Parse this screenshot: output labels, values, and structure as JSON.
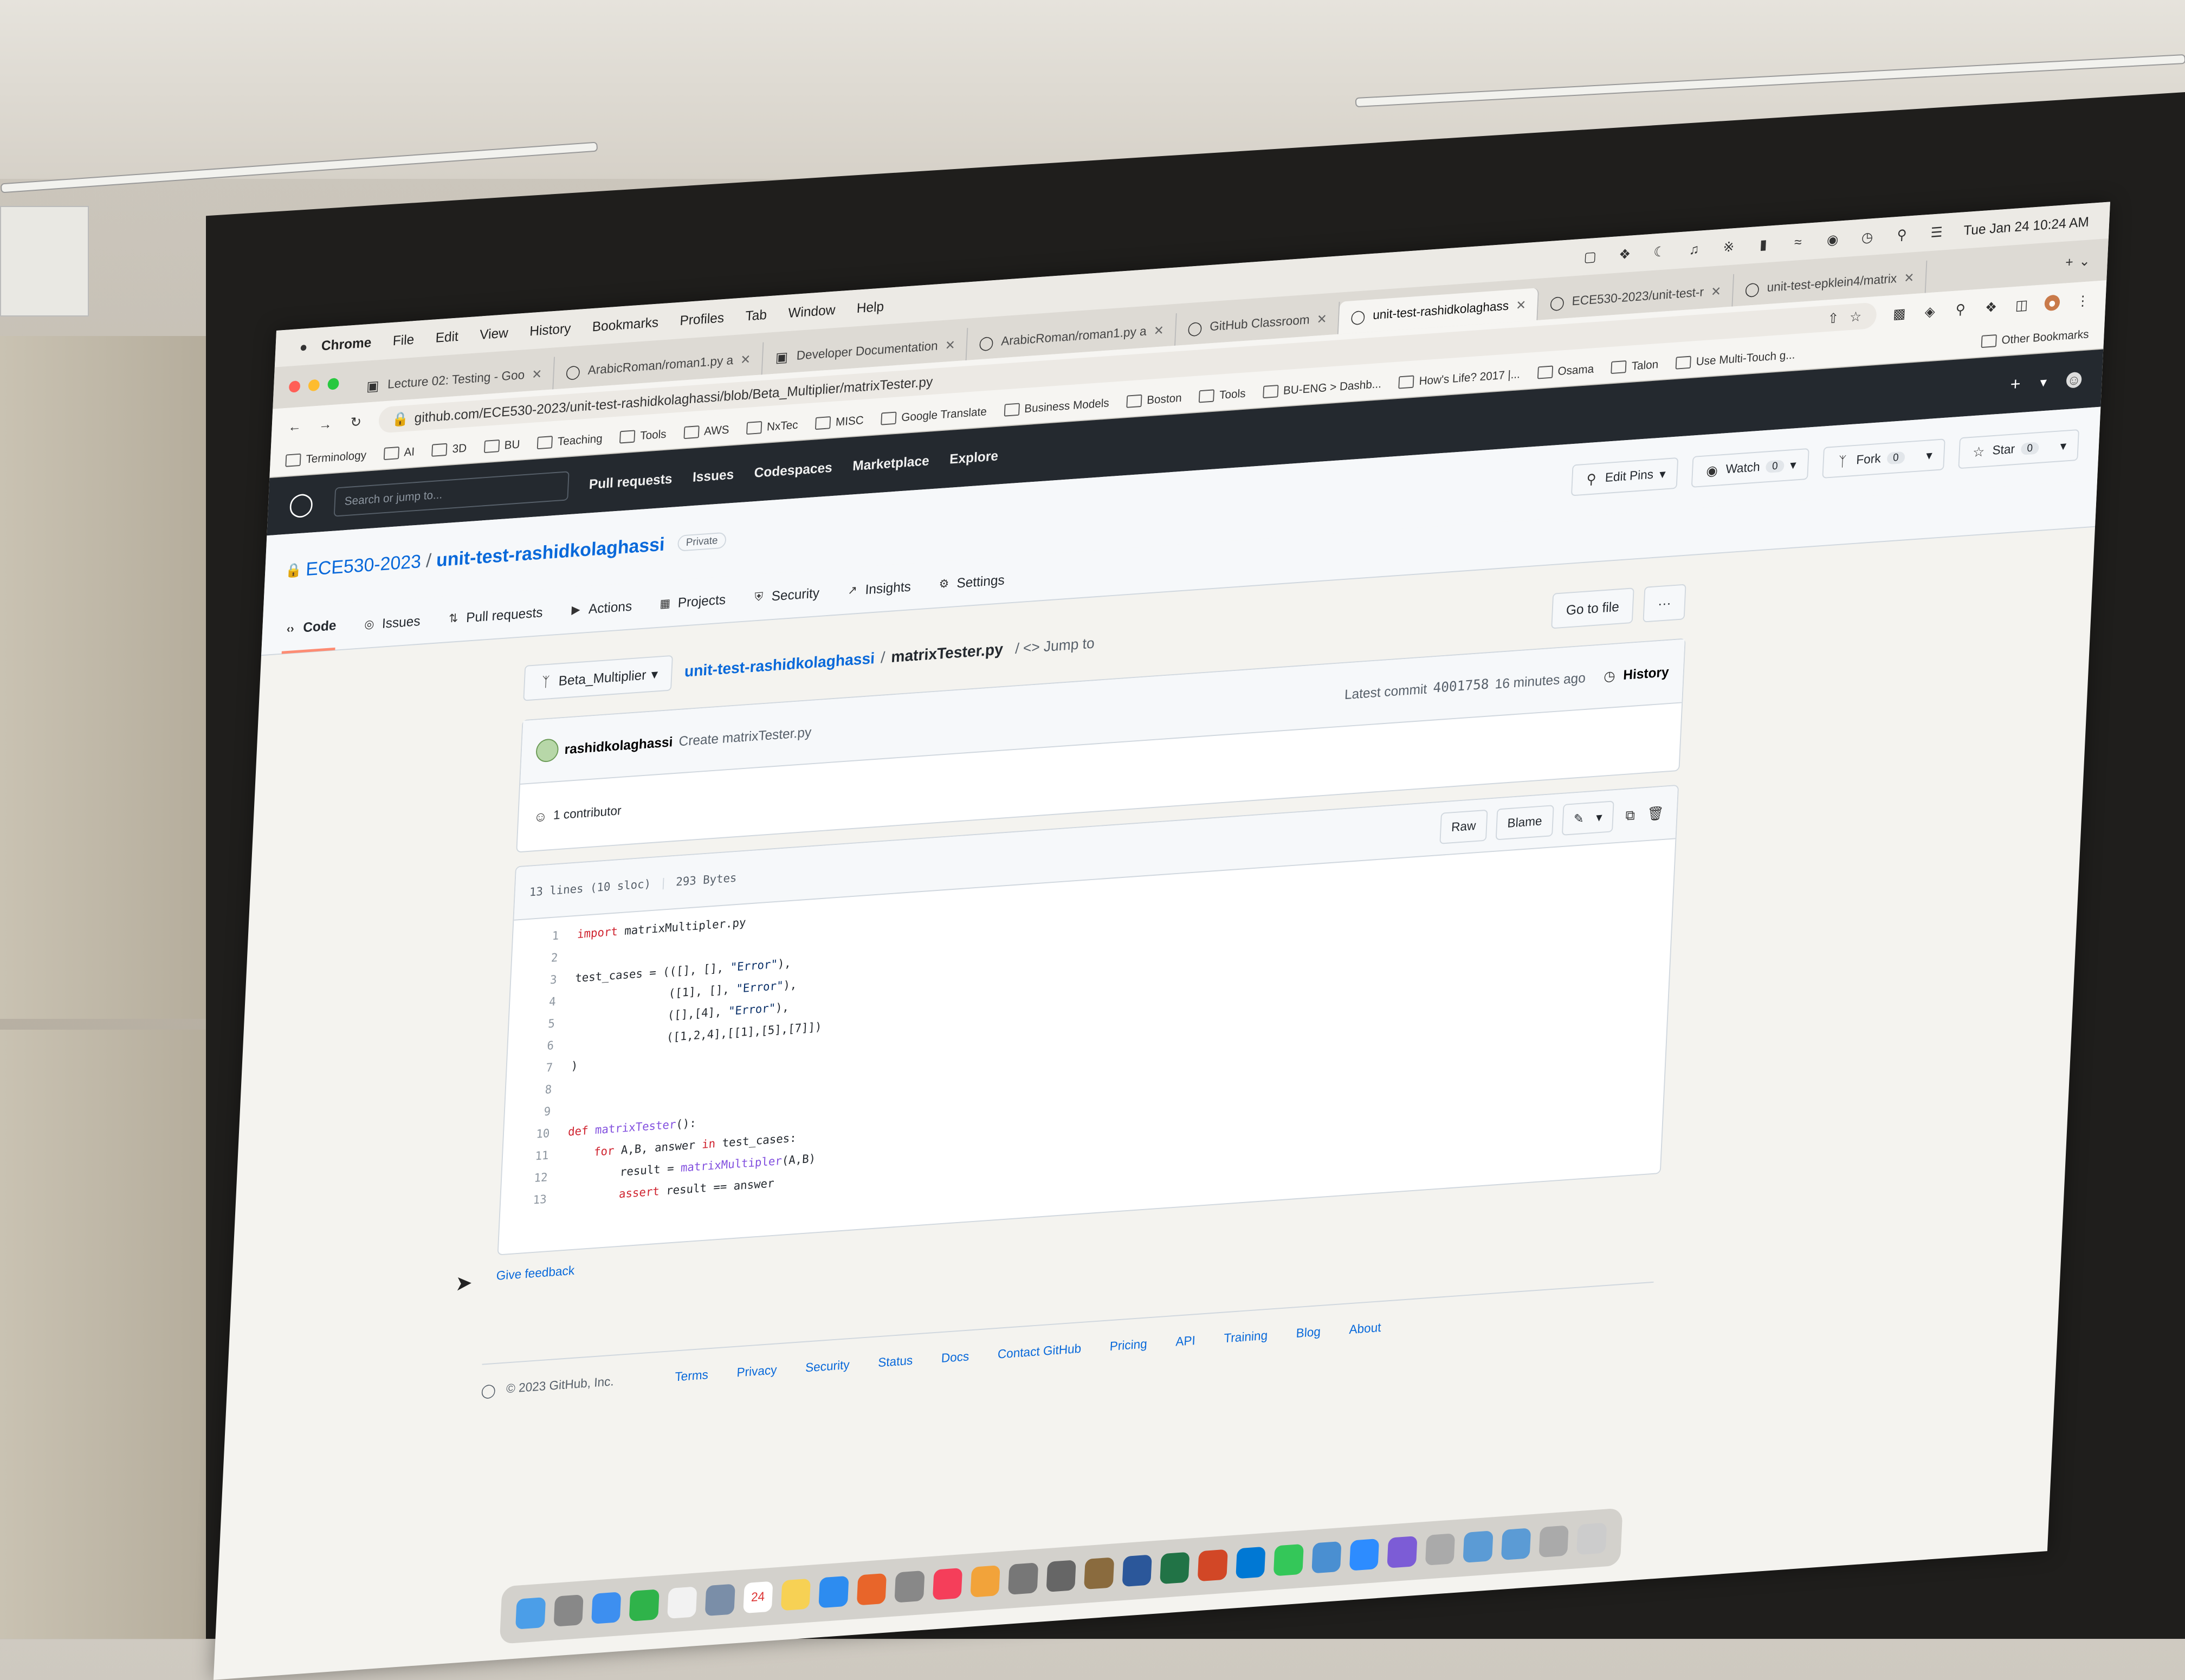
{
  "menubar": {
    "apple": "",
    "menus": [
      "Chrome",
      "File",
      "Edit",
      "View",
      "History",
      "Bookmarks",
      "Profiles",
      "Tab",
      "Window",
      "Help"
    ],
    "clock": "Tue Jan 24  10:24 AM"
  },
  "tabs": [
    {
      "label": "Lecture 02: Testing - Goo",
      "icon": "slides-icon"
    },
    {
      "label": "ArabicRoman/roman1.py a",
      "icon": "github-icon"
    },
    {
      "label": "Developer Documentation",
      "icon": "docs-icon"
    },
    {
      "label": "ArabicRoman/roman1.py a",
      "icon": "github-icon"
    },
    {
      "label": "GitHub Classroom",
      "icon": "github-icon"
    },
    {
      "label": "unit-test-rashidkolaghass",
      "icon": "github-icon",
      "active": true
    },
    {
      "label": "ECE530-2023/unit-test-r",
      "icon": "github-icon"
    },
    {
      "label": "unit-test-epklein4/matrix",
      "icon": "github-icon"
    }
  ],
  "address": {
    "url": "github.com/ECE530-2023/unit-test-rashidkolaghassi/blob/Beta_Multiplier/matrixTester.py"
  },
  "bookmarks": [
    "Terminology",
    "AI",
    "3D",
    "BU",
    "Teaching",
    "Tools",
    "AWS",
    "NxTec",
    "MISC",
    "Google Translate",
    "Business Models",
    "Boston",
    "Tools",
    "BU-ENG > Dashb...",
    "How's Life? 2017 |...",
    "Osama",
    "Talon",
    "Use Multi-Touch g...",
    "Other Bookmarks"
  ],
  "gh": {
    "search_placeholder": "Search or jump to...",
    "nav": [
      "Pull requests",
      "Issues",
      "Codespaces",
      "Marketplace",
      "Explore"
    ],
    "plus": "+",
    "owner": "ECE530-2023",
    "sep": "/",
    "repo": "unit-test-rashidkolaghassi",
    "visibility": "Private",
    "buttons": {
      "edit_pins": "Edit Pins",
      "watch": "Watch",
      "watch_count": "0",
      "fork": "Fork",
      "fork_count": "0",
      "star": "Star",
      "star_count": "0"
    },
    "repo_nav": [
      "Code",
      "Issues",
      "Pull requests",
      "Actions",
      "Projects",
      "Security",
      "Insights",
      "Settings"
    ]
  },
  "file": {
    "branch": "Beta_Multiplier",
    "crumb_repo": "unit-test-rashidkolaghassi",
    "crumb_sep": "/",
    "crumb_file": "matrixTester.py",
    "jump_to": "/ <> Jump to",
    "go_to_file": "Go to file",
    "more": "···",
    "commit_author": "rashidkolaghassi",
    "commit_msg": "Create matrixTester.py",
    "latest_commit_label": "Latest commit",
    "commit_sha": "4001758",
    "commit_time": "16 minutes ago",
    "history": "History",
    "contributors": "1 contributor",
    "lines_info": "13 lines (10 sloc)",
    "size_info": "293 Bytes",
    "raw": "Raw",
    "blame": "Blame",
    "code": [
      "import matrixMultipler.py",
      "",
      "test_cases = (([], [], \"Error\"),",
      "              ([1], [], \"Error\"),",
      "              ([],[4], \"Error\"),",
      "              ([1,2,4],[[1],[5],[7]])",
      ")",
      "",
      "",
      "def matrixTester():",
      "    for A,B, answer in test_cases:",
      "        result = matrixMultipler(A,B)",
      "        assert result == answer"
    ],
    "feedback": "Give feedback"
  },
  "footer": {
    "copyright": "© 2023 GitHub, Inc.",
    "links": [
      "Terms",
      "Privacy",
      "Security",
      "Status",
      "Docs",
      "Contact GitHub",
      "Pricing",
      "API",
      "Training",
      "Blog",
      "About"
    ]
  },
  "dock": {
    "calendar_day": "24",
    "icons": [
      "finder-icon",
      "launchpad-icon",
      "mail-icon",
      "facetime-icon",
      "chrome-icon",
      "preview-icon",
      "calendar-icon",
      "notes-icon",
      "safari-icon",
      "firefox-icon",
      "app-icon",
      "music-icon",
      "photos-icon",
      "settings-icon",
      "system-icon",
      "app-icon",
      "word-icon",
      "excel-icon",
      "powerpoint-icon",
      "skype-icon",
      "messages-icon",
      "search-icon",
      "zoom-icon",
      "app-icon",
      "app-icon",
      "folder-icon",
      "folder-icon",
      "help-icon",
      "trash-icon"
    ]
  },
  "colors": {
    "gh_header": "#24292f",
    "link": "#0969da",
    "accent_underline": "#fd8c73"
  }
}
